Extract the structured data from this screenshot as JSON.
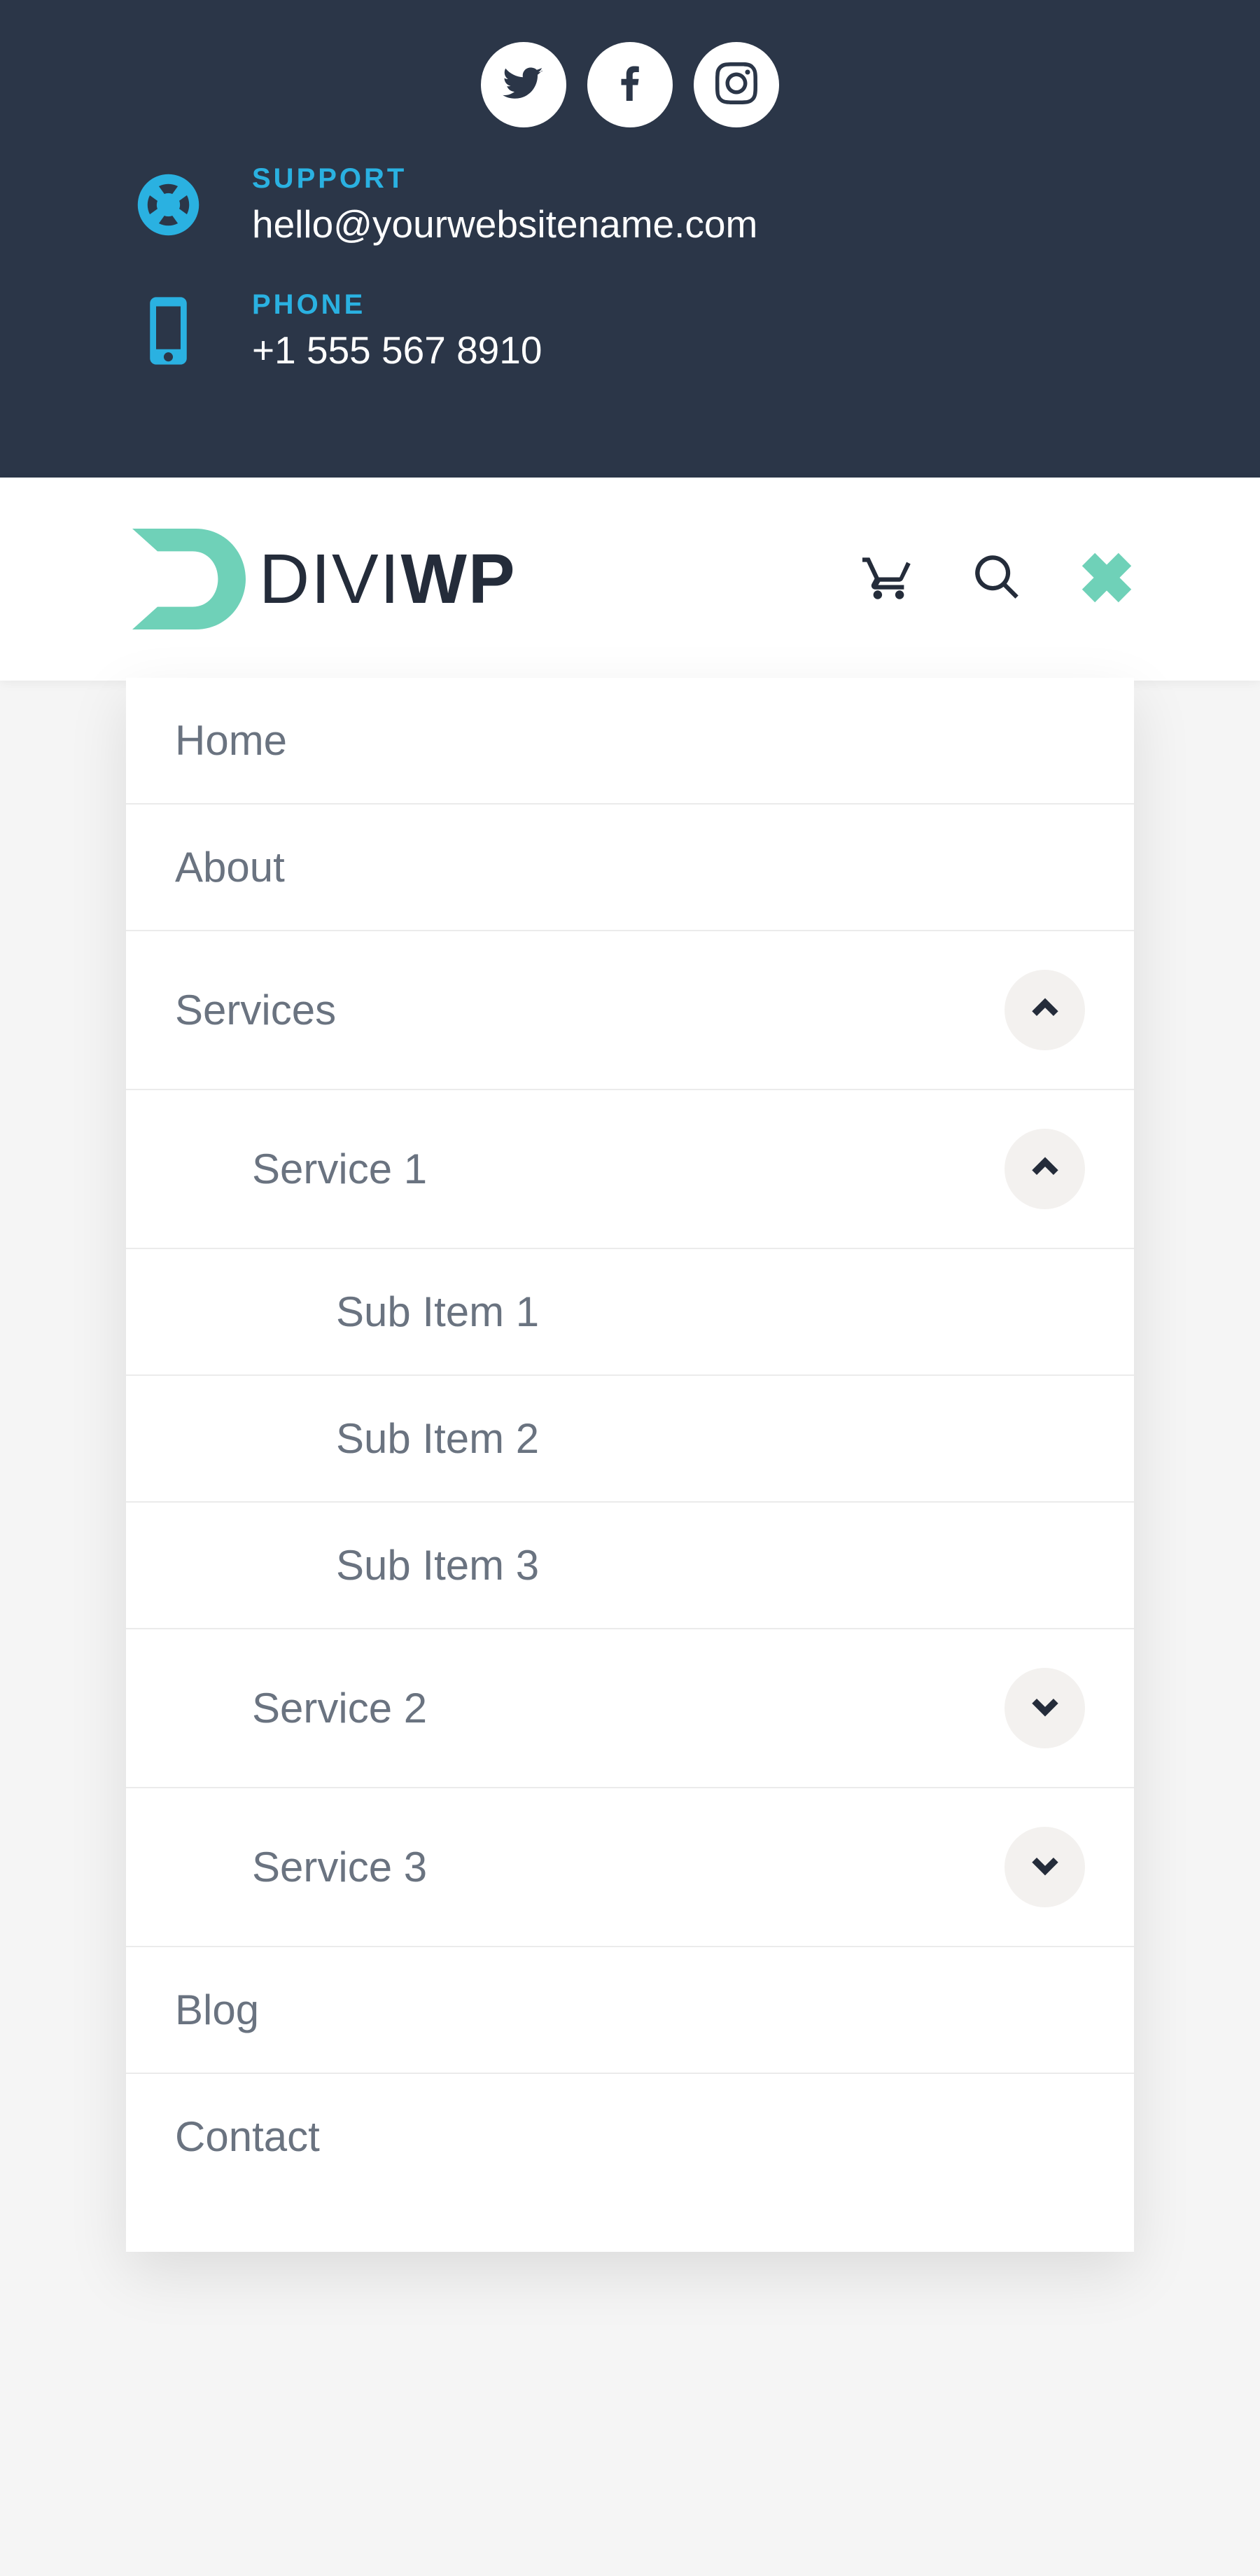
{
  "topbar": {
    "support_label": "SUPPORT",
    "support_value": "hello@yourwebsitename.com",
    "phone_label": "PHONE",
    "phone_value": "+1 555 567 8910"
  },
  "logo": {
    "text_a": "DIVI",
    "text_b": "WP"
  },
  "menu": {
    "home": "Home",
    "about": "About",
    "services": "Services",
    "service1": "Service 1",
    "sub1": "Sub Item 1",
    "sub2": "Sub Item 2",
    "sub3": "Sub Item 3",
    "service2": "Service 2",
    "service3": "Service 3",
    "blog": "Blog",
    "contact": "Contact"
  }
}
